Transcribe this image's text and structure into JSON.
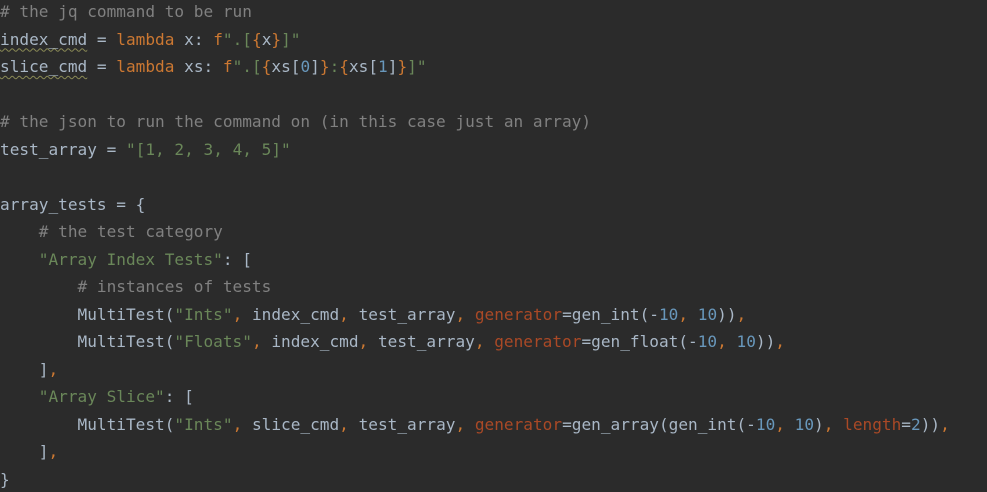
{
  "editor": {
    "background": "#2b2b2b",
    "colors": {
      "plain": "#a9b7c6",
      "comment": "#808080",
      "keyword": "#cc7832",
      "string": "#6a8759",
      "number": "#6897bb",
      "named_param": "#aa4926"
    },
    "lines": [
      {
        "tokens": [
          {
            "t": "# the jq command to be run",
            "c": "comment"
          }
        ]
      },
      {
        "tokens": [
          {
            "t": "index_cmd",
            "c": "plain",
            "warn": true
          },
          {
            "t": " = ",
            "c": "plain"
          },
          {
            "t": "lambda",
            "c": "keyword"
          },
          {
            "t": " x: ",
            "c": "plain"
          },
          {
            "t": "f",
            "c": "keyword"
          },
          {
            "t": "\".[",
            "c": "string"
          },
          {
            "t": "{",
            "c": "keyword"
          },
          {
            "t": "x",
            "c": "plain"
          },
          {
            "t": "}",
            "c": "keyword"
          },
          {
            "t": "]\"",
            "c": "string"
          }
        ]
      },
      {
        "tokens": [
          {
            "t": "slice_cmd",
            "c": "plain",
            "warn": true
          },
          {
            "t": " = ",
            "c": "plain"
          },
          {
            "t": "lambda",
            "c": "keyword"
          },
          {
            "t": " xs: ",
            "c": "plain"
          },
          {
            "t": "f",
            "c": "keyword"
          },
          {
            "t": "\".[",
            "c": "string"
          },
          {
            "t": "{",
            "c": "keyword"
          },
          {
            "t": "xs[",
            "c": "plain"
          },
          {
            "t": "0",
            "c": "number"
          },
          {
            "t": "]",
            "c": "plain"
          },
          {
            "t": "}",
            "c": "keyword"
          },
          {
            "t": ":",
            "c": "string"
          },
          {
            "t": "{",
            "c": "keyword"
          },
          {
            "t": "xs[",
            "c": "plain"
          },
          {
            "t": "1",
            "c": "number"
          },
          {
            "t": "]",
            "c": "plain"
          },
          {
            "t": "}",
            "c": "keyword"
          },
          {
            "t": "]\"",
            "c": "string"
          }
        ]
      },
      {
        "tokens": []
      },
      {
        "tokens": [
          {
            "t": "# the json to run the command on (in this case just an array)",
            "c": "comment"
          }
        ]
      },
      {
        "tokens": [
          {
            "t": "test_array",
            "c": "plain"
          },
          {
            "t": " = ",
            "c": "plain"
          },
          {
            "t": "\"[1, 2, 3, 4, 5]\"",
            "c": "string"
          }
        ]
      },
      {
        "tokens": []
      },
      {
        "tokens": [
          {
            "t": "array_tests",
            "c": "plain"
          },
          {
            "t": " = {",
            "c": "plain"
          }
        ]
      },
      {
        "tokens": [
          {
            "t": "    # the test category",
            "c": "comment"
          }
        ]
      },
      {
        "tokens": [
          {
            "t": "    ",
            "c": "plain"
          },
          {
            "t": "\"Array Index Tests\"",
            "c": "string"
          },
          {
            "t": ": [",
            "c": "plain"
          }
        ]
      },
      {
        "tokens": [
          {
            "t": "        # instances of tests",
            "c": "comment"
          }
        ]
      },
      {
        "tokens": [
          {
            "t": "        MultiTest(",
            "c": "plain"
          },
          {
            "t": "\"Ints\"",
            "c": "string"
          },
          {
            "t": ", ",
            "c": "keyword"
          },
          {
            "t": "index_cmd",
            "c": "plain"
          },
          {
            "t": ", ",
            "c": "keyword"
          },
          {
            "t": "test_array",
            "c": "plain"
          },
          {
            "t": ", ",
            "c": "keyword"
          },
          {
            "t": "generator",
            "c": "named_param"
          },
          {
            "t": "=gen_int(-",
            "c": "plain"
          },
          {
            "t": "10",
            "c": "number"
          },
          {
            "t": ", ",
            "c": "keyword"
          },
          {
            "t": "10",
            "c": "number"
          },
          {
            "t": "))",
            "c": "plain"
          },
          {
            "t": ",",
            "c": "keyword"
          }
        ]
      },
      {
        "tokens": [
          {
            "t": "        MultiTest(",
            "c": "plain"
          },
          {
            "t": "\"Floats\"",
            "c": "string"
          },
          {
            "t": ", ",
            "c": "keyword"
          },
          {
            "t": "index_cmd",
            "c": "plain"
          },
          {
            "t": ", ",
            "c": "keyword"
          },
          {
            "t": "test_array",
            "c": "plain"
          },
          {
            "t": ", ",
            "c": "keyword"
          },
          {
            "t": "generator",
            "c": "named_param"
          },
          {
            "t": "=gen_float(-",
            "c": "plain"
          },
          {
            "t": "10",
            "c": "number"
          },
          {
            "t": ", ",
            "c": "keyword"
          },
          {
            "t": "10",
            "c": "number"
          },
          {
            "t": "))",
            "c": "plain"
          },
          {
            "t": ",",
            "c": "keyword"
          }
        ]
      },
      {
        "tokens": [
          {
            "t": "    ]",
            "c": "plain"
          },
          {
            "t": ",",
            "c": "keyword"
          }
        ]
      },
      {
        "tokens": [
          {
            "t": "    ",
            "c": "plain"
          },
          {
            "t": "\"Array Slice\"",
            "c": "string"
          },
          {
            "t": ": [",
            "c": "plain"
          }
        ]
      },
      {
        "tokens": [
          {
            "t": "        MultiTest(",
            "c": "plain"
          },
          {
            "t": "\"Ints\"",
            "c": "string"
          },
          {
            "t": ", ",
            "c": "keyword"
          },
          {
            "t": "slice_cmd",
            "c": "plain"
          },
          {
            "t": ", ",
            "c": "keyword"
          },
          {
            "t": "test_array",
            "c": "plain"
          },
          {
            "t": ", ",
            "c": "keyword"
          },
          {
            "t": "generator",
            "c": "named_param"
          },
          {
            "t": "=gen_array(gen_int(-",
            "c": "plain"
          },
          {
            "t": "10",
            "c": "number"
          },
          {
            "t": ", ",
            "c": "keyword"
          },
          {
            "t": "10",
            "c": "number"
          },
          {
            "t": ")",
            "c": "plain"
          },
          {
            "t": ", ",
            "c": "keyword"
          },
          {
            "t": "length",
            "c": "named_param"
          },
          {
            "t": "=",
            "c": "plain"
          },
          {
            "t": "2",
            "c": "number"
          },
          {
            "t": "))",
            "c": "plain"
          },
          {
            "t": ",",
            "c": "keyword"
          }
        ]
      },
      {
        "tokens": [
          {
            "t": "    ]",
            "c": "plain"
          },
          {
            "t": ",",
            "c": "keyword"
          }
        ]
      },
      {
        "tokens": [
          {
            "t": "}",
            "c": "plain"
          }
        ]
      }
    ]
  }
}
